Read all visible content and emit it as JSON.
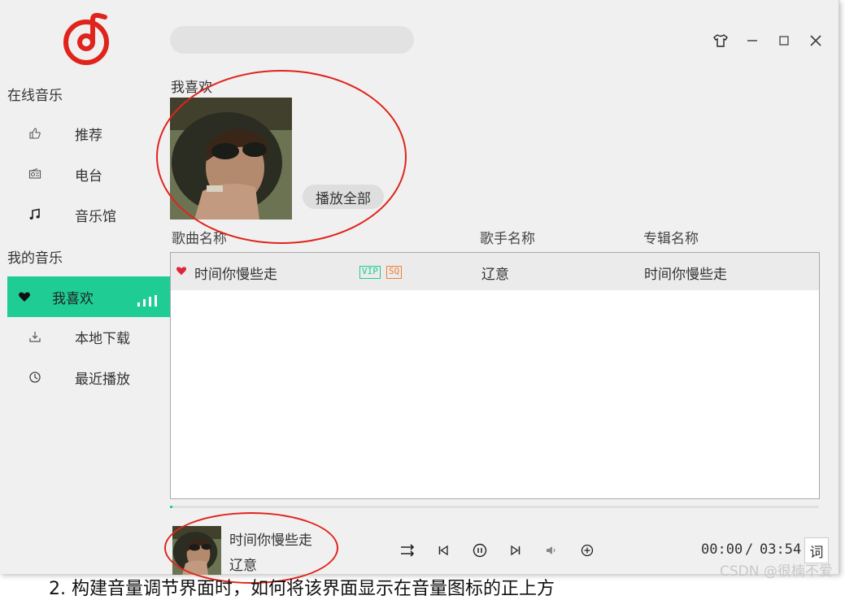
{
  "sidebar": {
    "online_title": "在线音乐",
    "my_title": "我的音乐",
    "online_items": [
      {
        "label": "推荐",
        "icon": "thumbs-up-icon"
      },
      {
        "label": "电台",
        "icon": "radio-icon"
      },
      {
        "label": "音乐馆",
        "icon": "music-note-icon"
      }
    ],
    "my_items": [
      {
        "label": "我喜欢",
        "icon": "heart-icon",
        "active": true
      },
      {
        "label": "本地下载",
        "icon": "download-icon"
      },
      {
        "label": "最近播放",
        "icon": "history-icon"
      }
    ]
  },
  "search": {
    "placeholder": ""
  },
  "favorites": {
    "title": "我喜欢",
    "play_all_label": "播放全部"
  },
  "table": {
    "columns": [
      "歌曲名称",
      "歌手名称",
      "专辑名称"
    ],
    "rows": [
      {
        "title": "时间你慢些走",
        "vip": "VIP",
        "sq": "SQ",
        "artist": "辽意",
        "album": "时间你慢些走",
        "liked": true
      }
    ]
  },
  "player": {
    "title": "时间你慢些走",
    "artist": "辽意",
    "current_time": "00:00",
    "separator": "/",
    "total_time": "03:54",
    "lyric_label": "词",
    "progress": 0.002
  },
  "footer": {
    "partial_text": "2. 构建音量调节界面时，如何将该界面显示在音量图标的正上方",
    "watermark": "CSDN @很楠不爱"
  },
  "colors": {
    "accent": "#1ecc94",
    "logo_red": "#e0241c",
    "annotation_red": "#e0241c",
    "vip_tag": "#1ecc94",
    "sq_tag": "#f07f3a"
  }
}
